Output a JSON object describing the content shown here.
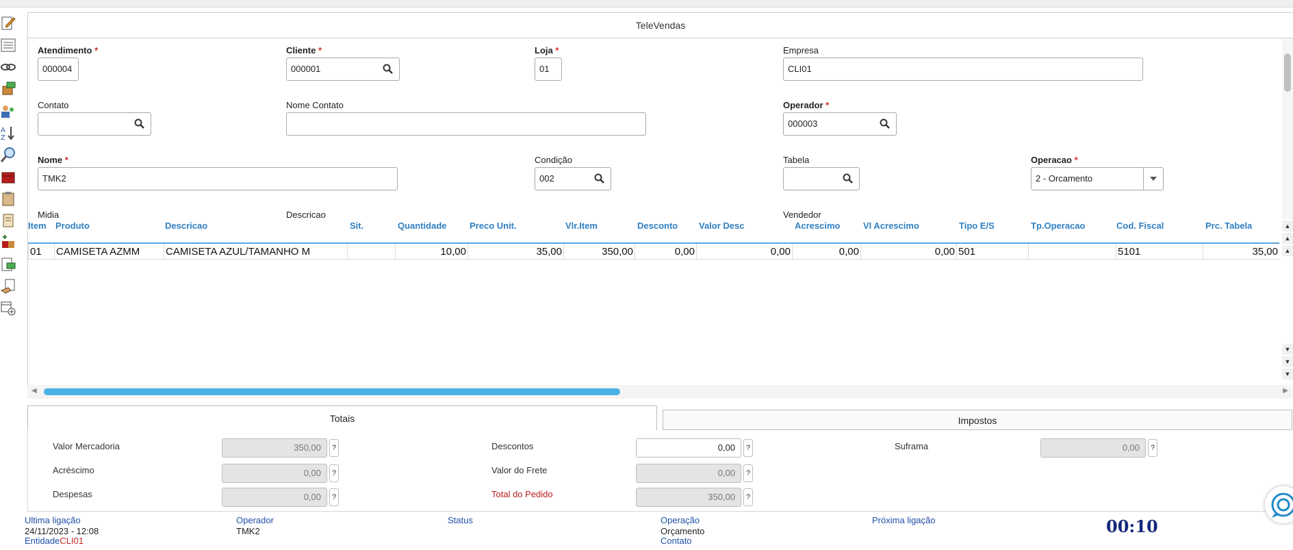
{
  "window": {
    "title": "TeleVendas"
  },
  "form": {
    "atendimento": {
      "label": "Atendimento",
      "value": "000004"
    },
    "cliente": {
      "label": "Cliente",
      "value": "000001"
    },
    "loja": {
      "label": "Loja",
      "value": "01"
    },
    "empresa": {
      "label": "Empresa",
      "value": "CLI01"
    },
    "contato": {
      "label": "Contato",
      "value": ""
    },
    "nome_contato": {
      "label": "Nome Contato",
      "value": ""
    },
    "operador": {
      "label": "Operador",
      "value": "000003"
    },
    "nome": {
      "label": "Nome",
      "value": "TMK2"
    },
    "condicao": {
      "label": "Condição",
      "value": "002"
    },
    "tabela": {
      "label": "Tabela",
      "value": ""
    },
    "operacao": {
      "label": "Operacao",
      "value": "2 - Orcamento"
    },
    "midia": {
      "label": "Midia"
    },
    "descricao": {
      "label": "Descricao"
    },
    "vendedor": {
      "label": "Vendedor"
    },
    "required_mark": "*"
  },
  "grid": {
    "headers": [
      "Item",
      "Produto",
      "Descricao",
      "Sit.",
      "Quantidade",
      "Preco Unit.",
      "Vlr.Item",
      "Desconto",
      "Valor Desc",
      "Acrescimo",
      "Vl Acrescimo",
      "Tipo E/S",
      "Tp.Operacao",
      "Cod. Fiscal",
      "Prc. Tabela"
    ],
    "rows": [
      [
        "01",
        "CAMISETA   AZMM",
        "CAMISETA AZUL/TAMANHO M",
        "",
        "10,00",
        "35,00",
        "350,00",
        "0,00",
        "0,00",
        "0,00",
        "0,00",
        "501",
        "",
        "5101",
        "35,00"
      ]
    ]
  },
  "tabs": {
    "totais": "Totais",
    "impostos": "Impostos"
  },
  "totais": {
    "valor_mercadoria": {
      "label": "Valor Mercadoria",
      "value": "350,00"
    },
    "acrescimo": {
      "label": "Acréscimo",
      "value": "0,00"
    },
    "despesas": {
      "label": "Despesas",
      "value": "0,00"
    },
    "descontos": {
      "label": "Descontos",
      "value": "0,00"
    },
    "valor_frete": {
      "label": "Valor do Frete",
      "value": "0,00"
    },
    "total_pedido": {
      "label": "Total do Pedido",
      "value": "350,00"
    },
    "suframa": {
      "label": "Suframa",
      "value": "0,00"
    },
    "help": "?"
  },
  "footer": {
    "ultima_ligacao": {
      "label": "Ultima ligação",
      "value": "24/11/2023 - 12:08"
    },
    "entidade": {
      "label": "Entidade",
      "value": "CLI01"
    },
    "operador": {
      "label": "Operador",
      "value": "TMK2"
    },
    "status": {
      "label": "Status"
    },
    "operacao": {
      "label": "Operação",
      "value": "Orçamento"
    },
    "contato": {
      "label": "Contato"
    },
    "proxima_ligacao": {
      "label": "Próxima ligação"
    },
    "timer": "00:10"
  },
  "icons": [
    "edit-icon",
    "list-icon",
    "link-icon",
    "money-box-icon",
    "users-icon",
    "sort-icon",
    "magnifier-icon",
    "box-icon",
    "clipboard-icon",
    "scroll-icon",
    "boxes-add-icon",
    "money-doc-icon",
    "hand-doc-icon",
    "calendar-add-icon"
  ],
  "colors": {
    "accent": "#2f7fc1",
    "required": "#d32f2f",
    "timer": "#14287a",
    "scroll_thumb": "#4bb0e6"
  }
}
